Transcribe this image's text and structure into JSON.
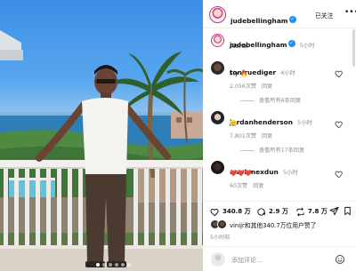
{
  "post": {
    "username": "judebellingham",
    "follow_label": "已关注",
    "more_icon": "more-icon",
    "caption_username": "judebellingham",
    "caption_time": "5小时",
    "caption_text": "Aloha."
  },
  "comments": [
    {
      "username": "toniruediger",
      "time": "4小时",
      "text": "Fly 🔥",
      "likes": "2,056次赞",
      "reply": "回复",
      "view_replies": "查看所有6条回复"
    },
    {
      "username": "jordanhenderson",
      "time": "5小时",
      "text": "🫡",
      "likes": "7,801次赞",
      "reply": "回复",
      "view_replies": "查看所有17条回复"
    },
    {
      "username": "marlenexdun",
      "time": "5小时",
      "text": "❤️❤️❤️",
      "likes": "60次赞",
      "reply": "回复",
      "view_replies": ""
    }
  ],
  "actions": {
    "likes": "340.8 万",
    "comments": "2.9 万",
    "shares": "7.8 万"
  },
  "liked_by": "vinijr和其他340.7万位用户赞了",
  "post_date": "5小时前",
  "add_comment": {
    "placeholder": "添加评论…"
  },
  "colors": {
    "verified": "#1f8ef1",
    "muted": "#8e8e8e",
    "text": "#111111",
    "story_ring": "#c13584"
  }
}
